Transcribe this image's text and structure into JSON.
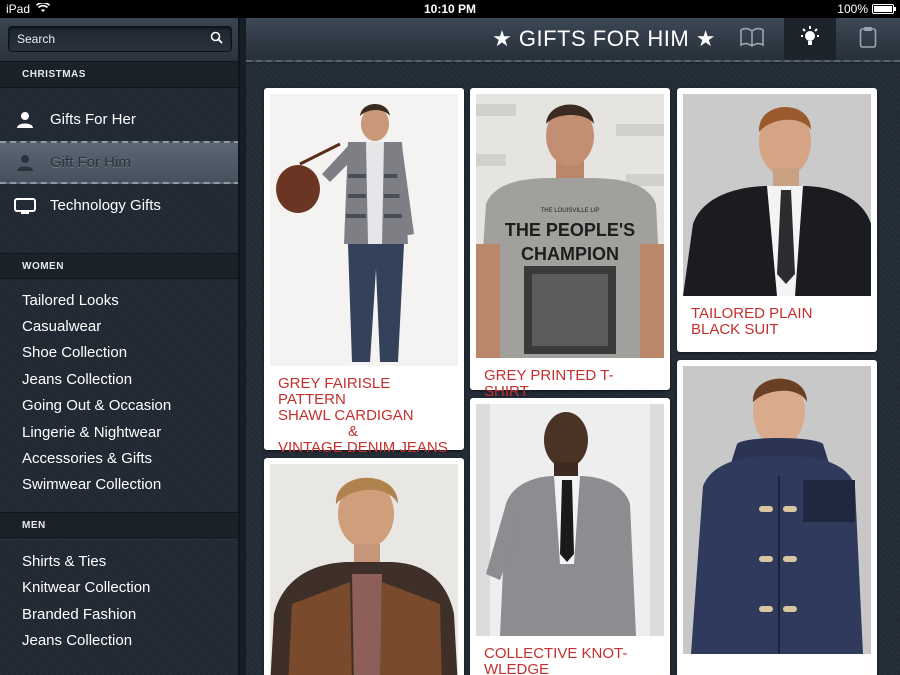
{
  "status": {
    "device": "iPad",
    "time": "10:10 PM",
    "battery": "100%",
    "battery_level": 1.0
  },
  "search": {
    "placeholder": "Search"
  },
  "sidebar": {
    "christmas_header": "CHRISTMAS",
    "christmas_items": [
      {
        "label": "Gifts For Her",
        "icon": "person-icon"
      },
      {
        "label": "Gift For Him",
        "icon": "person-icon"
      },
      {
        "label": "Technology Gifts",
        "icon": "tv-icon"
      }
    ],
    "women_header": "WOMEN",
    "women_items": [
      "Tailored Looks",
      "Casualwear",
      "Shoe Collection",
      "Jeans Collection",
      "Going Out & Occasion",
      "Lingerie & Nightwear",
      "Accessories & Gifts",
      "Swimwear Collection"
    ],
    "men_header": "MEN",
    "men_items": [
      "Shirts & Ties",
      "Knitwear Collection",
      "Branded Fashion",
      "Jeans Collection"
    ]
  },
  "header": {
    "title": "★ GIFTS FOR HIM ★"
  },
  "products": [
    {
      "line1": "GREY FAIRISLE PATTERN",
      "line2": "SHAWL CARDIGAN",
      "line3": "&",
      "line4": "VINTAGE DENIM JEANS"
    },
    {
      "line1": "GREY PRINTED T-SHIRT",
      "tshirt_text": "THE PEOPLE'S CHAMPION",
      "tshirt_small": "THE LOUISVILLE LIP"
    },
    {
      "line1": "TAILORED PLAIN",
      "line2": "BLACK SUIT"
    },
    {
      "line1": "COLLECTIVE KNOT-",
      "line2": "WLEDGE"
    },
    {
      "line1": ""
    },
    {
      "line1": ""
    }
  ],
  "colors": {
    "accent_red": "#c3302e",
    "sidebar_bg": "#222a34"
  }
}
